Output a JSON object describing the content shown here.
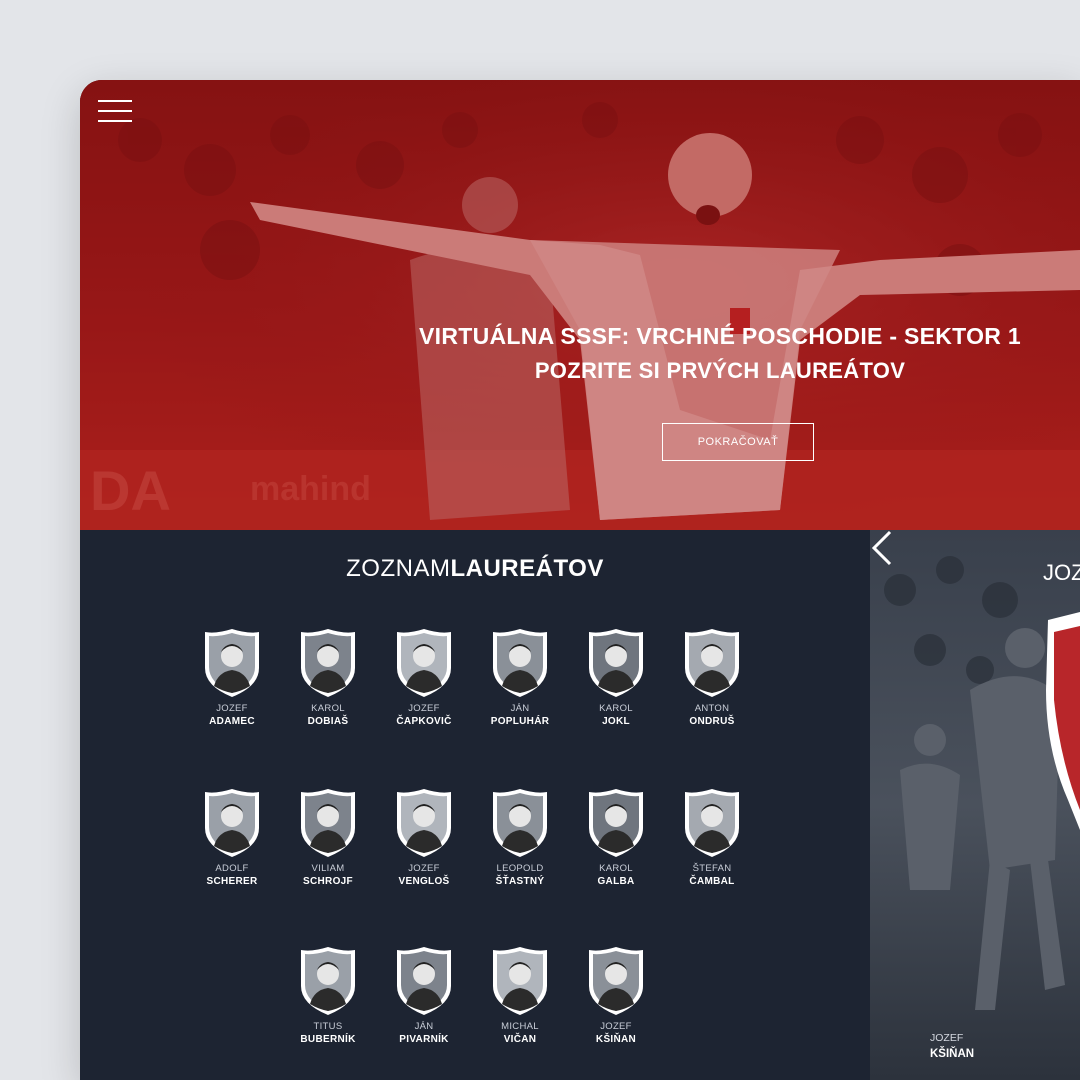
{
  "hero": {
    "title": "VIRTUÁLNA SSSF: VRCHNÉ POSCHODIE - SEKTOR 1",
    "subtitle": "POZRITE SI PRVÝCH LAUREÁTOV",
    "button_label": "POKRAČOVAŤ"
  },
  "list": {
    "title_light": "ZOZNAM",
    "title_bold": "LAUREÁTOV",
    "laureates": [
      {
        "first": "JOZEF",
        "last": "ADAMEC"
      },
      {
        "first": "KAROL",
        "last": "DOBIAŠ"
      },
      {
        "first": "JOZEF",
        "last": "ČAPKOVIČ"
      },
      {
        "first": "JÁN",
        "last": "POPLUHÁR"
      },
      {
        "first": "KAROL",
        "last": "JOKL"
      },
      {
        "first": "ANTON",
        "last": "ONDRUŠ"
      },
      {
        "first": "ADOLF",
        "last": "SCHERER"
      },
      {
        "first": "VILIAM",
        "last": "SCHROJF"
      },
      {
        "first": "JOZEF",
        "last": "VENGLOŠ"
      },
      {
        "first": "LEOPOLD",
        "last": "ŠŤASTNÝ"
      },
      {
        "first": "KAROL",
        "last": "GALBA"
      },
      {
        "first": "ŠTEFAN",
        "last": "ČAMBAL"
      },
      {
        "first": "TITUS",
        "last": "BUBERNÍK"
      },
      {
        "first": "JÁN",
        "last": "PIVARNÍK"
      },
      {
        "first": "MICHAL",
        "last": "VIČAN"
      },
      {
        "first": "JOZEF",
        "last": "KŠIŇAN"
      }
    ]
  },
  "feature": {
    "heading": "JOZ",
    "first": "JOZEF",
    "last": "KŠIŇAN"
  },
  "colors": {
    "hero_red": "#a31616",
    "panel_navy": "#1d2432",
    "background": "#e3e5e9"
  },
  "icons": {
    "menu": "hamburger-icon",
    "prev": "chevron-left-icon"
  }
}
